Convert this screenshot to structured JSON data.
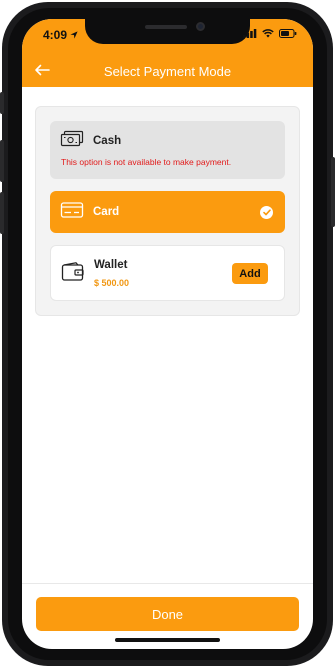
{
  "status_bar": {
    "time": "4:09"
  },
  "header": {
    "title": "Select Payment Mode"
  },
  "options": {
    "cash": {
      "label": "Cash",
      "message": "This option is not available to make payment."
    },
    "card": {
      "label": "Card",
      "selected": true
    },
    "wallet": {
      "label": "Wallet",
      "balance": "$ 500.00",
      "add_label": "Add"
    }
  },
  "footer": {
    "done_label": "Done"
  },
  "colors": {
    "accent": "#fb9b0f",
    "error": "#e21b1b",
    "panel": "#f3f3f3",
    "disabled": "#e3e3e3"
  },
  "icons": [
    "back-arrow-icon",
    "location-arrow-icon",
    "signal-icon",
    "wifi-icon",
    "battery-icon",
    "cash-icon",
    "card-icon",
    "check-icon",
    "wallet-icon"
  ]
}
